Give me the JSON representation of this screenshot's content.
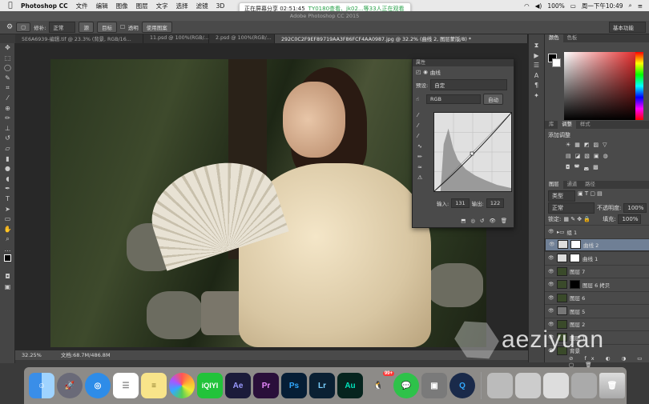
{
  "menubar": {
    "app_name": "Photoshop CC",
    "items": [
      "文件",
      "编辑",
      "图像",
      "图层",
      "文字",
      "选择",
      "滤镜",
      "3D"
    ],
    "battery": "100%",
    "clock": "周一下午10:49"
  },
  "share_banner": {
    "text": "正在屏幕分享 02:51:45",
    "highlight": "TY0180查看、jk02...等33人正在观看"
  },
  "window_title": "Adobe Photoshop CC 2015",
  "options": {
    "feather_label": "修补:",
    "mode_value": "正常",
    "source_btn": "源",
    "dest_btn": "目标",
    "transparent_label": "透明",
    "use_pattern_btn": "使用图案",
    "workspace": "基本功能"
  },
  "tabs": [
    "5E6A6939-编辑.tif @ 23.3% (背景, RGB/16...",
    "11.psd @ 100%(RGB/...",
    "2.psd @ 100%(RGB/...",
    "292C0C2F9EF89719AA3F86FCF4AA0987.jpg @ 32.2% (曲线 2, 图层蒙版/8) *"
  ],
  "status": {
    "zoom": "32.25%",
    "doc": "文档:68.7M/486.8M"
  },
  "properties": {
    "panel_title": "属性",
    "title": "曲线",
    "preset_label": "预设:",
    "preset_value": "自定",
    "channel": "RGB",
    "auto_btn": "自动",
    "input_label": "输入:",
    "input_value": "131",
    "output_label": "输出:",
    "output_value": "122"
  },
  "right_tabs": {
    "color": [
      "颜色",
      "色板"
    ],
    "adjust": [
      "库",
      "调整",
      "样式"
    ],
    "adjust_label": "添加调整",
    "layers": [
      "图层",
      "通道",
      "路径"
    ]
  },
  "layers_panel": {
    "kind": "类型",
    "blend": "正常",
    "opacity_label": "不透明度:",
    "opacity": "100%",
    "lock_label": "锁定:",
    "fill_label": "填充:",
    "fill": "100%",
    "items": [
      {
        "name": "组 1",
        "selected": false
      },
      {
        "name": "曲线 2",
        "selected": true
      },
      {
        "name": "曲线 1",
        "selected": false
      },
      {
        "name": "图层 7",
        "selected": false
      },
      {
        "name": "图层 6 拷贝",
        "selected": false
      },
      {
        "name": "图层 6",
        "selected": false
      },
      {
        "name": "图层 5",
        "selected": false
      },
      {
        "name": "图层 2",
        "selected": false
      },
      {
        "name": "图层 1",
        "selected": false
      },
      {
        "name": "背景",
        "selected": false
      }
    ]
  },
  "dock": {
    "apps": [
      "Finder",
      "Launchpad",
      "Safari",
      "Reminders",
      "Notes",
      "Photos",
      "iQIYI",
      "Ae",
      "Pr",
      "Ps",
      "Lr",
      "Au",
      "QQ",
      "WeChat",
      "Screen",
      "QuickTime",
      "Trash"
    ],
    "qq_badge": "99+"
  },
  "watermark": "aeziyuan"
}
